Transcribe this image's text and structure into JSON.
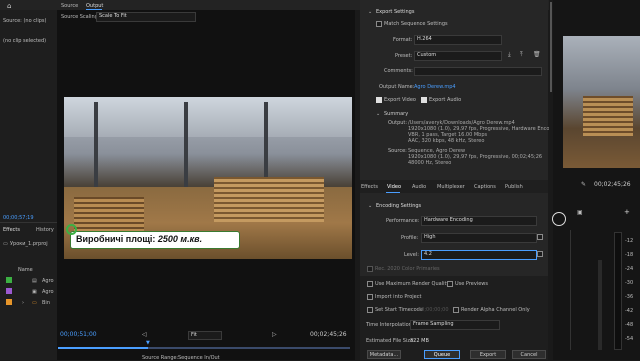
{
  "left_panel": {
    "source_label": "Source: (no clips)",
    "no_clip": "(no clip selected)",
    "timecode": "00;00;57;19",
    "tabs": [
      "Effects",
      "History"
    ],
    "project_name": "Уроки_1.prproj",
    "name_header": "Name",
    "items": [
      "Agro",
      "Agro",
      "Bin"
    ]
  },
  "preview": {
    "tabs": [
      "Source",
      "Output"
    ],
    "scaling_label": "Source Scaling:",
    "scaling_value": "Scale To Fit",
    "overlay_text_plain": "Виробничі площі: ",
    "overlay_text_italic": "2500 м.кв.",
    "timecode_left": "00;00;51;00",
    "timecode_right": "00;02;45;26",
    "fit_value": "Fit",
    "source_range_label": "Source Range:",
    "source_range_value": "Sequence In/Out"
  },
  "export": {
    "section_title": "Export Settings",
    "match_label": "Match Sequence Settings",
    "format_label": "Format:",
    "format_value": "H.264",
    "preset_label": "Preset:",
    "preset_value": "Custom",
    "comments_label": "Comments:",
    "output_name_label": "Output Name:",
    "output_name_value": "Agro Derew.mp4",
    "export_video_label": "Export Video",
    "export_audio_label": "Export Audio",
    "summary_title": "Summary",
    "summary_output_label": "Output:",
    "summary_output_lines": [
      "/Users/averyk/Downloads/Agro Derew.mp4",
      "1920x1080 (1.0), 29,97 fps, Progressive, Hardware Encoding...",
      "VBR, 1 pass, Target 16.00 Mbps",
      "AAC, 320 kbps, 48 kHz, Stereo"
    ],
    "summary_source_label": "Source:",
    "summary_source_lines": [
      "Sequence, Agro Derew",
      "1920x1080 (1.0), 29,97 fps, Progressive, 00;02;45;26",
      "48000 Hz, Stereo"
    ],
    "tabs": [
      "Effects",
      "Video",
      "Audio",
      "Multiplexer",
      "Captions",
      "Publish"
    ],
    "active_tab": "Video",
    "encoding_title": "Encoding Settings",
    "performance_label": "Performance:",
    "performance_value": "Hardware Encoding",
    "profile_label": "Profile:",
    "profile_value": "High",
    "level_label": "Level:",
    "level_value": "4.2",
    "rec_label": "Rec. 2020 Color Primaries",
    "max_render_label": "Use Maximum Render Quality",
    "use_previews_label": "Use Previews",
    "import_label": "Import into Project",
    "set_start_label": "Set Start Timecode",
    "start_tc": "00;00;00;00",
    "render_alpha_label": "Render Alpha Channel Only",
    "time_interp_label": "Time Interpolation:",
    "time_interp_value": "Frame Sampling",
    "file_size_label": "Estimated File Size:",
    "file_size_value": "322 MB",
    "metadata_btn": "Metadata...",
    "queue_btn": "Queue",
    "export_btn": "Export",
    "cancel_btn": "Cancel"
  },
  "right_panel": {
    "timecode": "00;02;45;26",
    "meter_labels": [
      "-12",
      "-18",
      "-24",
      "-30",
      "-36",
      "-42",
      "-48",
      "-54"
    ]
  }
}
